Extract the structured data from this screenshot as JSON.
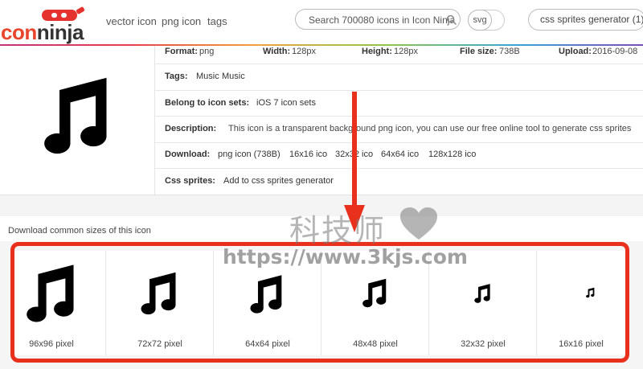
{
  "header": {
    "logo": {
      "part1": "con",
      "part2": "ninja"
    },
    "nav": [
      "vector icon",
      "png icon",
      "tags"
    ],
    "search": {
      "value": "Search 700080 icons in Icon Ninja"
    },
    "format_toggle": "svg",
    "css_sprites_button": "css sprites generator (1)"
  },
  "details": {
    "meta": [
      {
        "label": "Format:",
        "value": "png"
      },
      {
        "label": "Width:",
        "value": "128px"
      },
      {
        "label": "Height:",
        "value": "128px"
      },
      {
        "label": "File size:",
        "value": "738B"
      },
      {
        "label": "Upload:",
        "value": "2016-09-08"
      }
    ],
    "tags": {
      "label": "Tags:",
      "values": [
        "Music",
        "Music"
      ]
    },
    "icon_sets": {
      "label": "Belong to icon sets:",
      "value": "iOS 7 icon sets"
    },
    "description": {
      "label": "Description:",
      "value": "This icon is a transparent background png icon, you can use our free online tool to generate css sprites"
    },
    "download": {
      "label": "Download:",
      "links": [
        "png icon (738B)",
        "16x16 ico",
        "32x32 ico",
        "64x64 ico",
        "128x128 ico"
      ]
    },
    "css_sprites": {
      "label": "Css sprites:",
      "value": "Add to css sprites generator"
    }
  },
  "sizes": {
    "title": "Download common sizes of this icon",
    "items": [
      "96x96 pixel",
      "72x72 pixel",
      "64x64 pixel",
      "48x48 pixel",
      "32x32 pixel",
      "16x16 pixel"
    ]
  },
  "watermark": {
    "cn": "科技师",
    "url": "https://www.3kjs.com"
  },
  "colors": {
    "annotation_red": "#e8301c",
    "logo_red": "#e5322e"
  },
  "icons": {
    "main": "music-note-icon"
  }
}
